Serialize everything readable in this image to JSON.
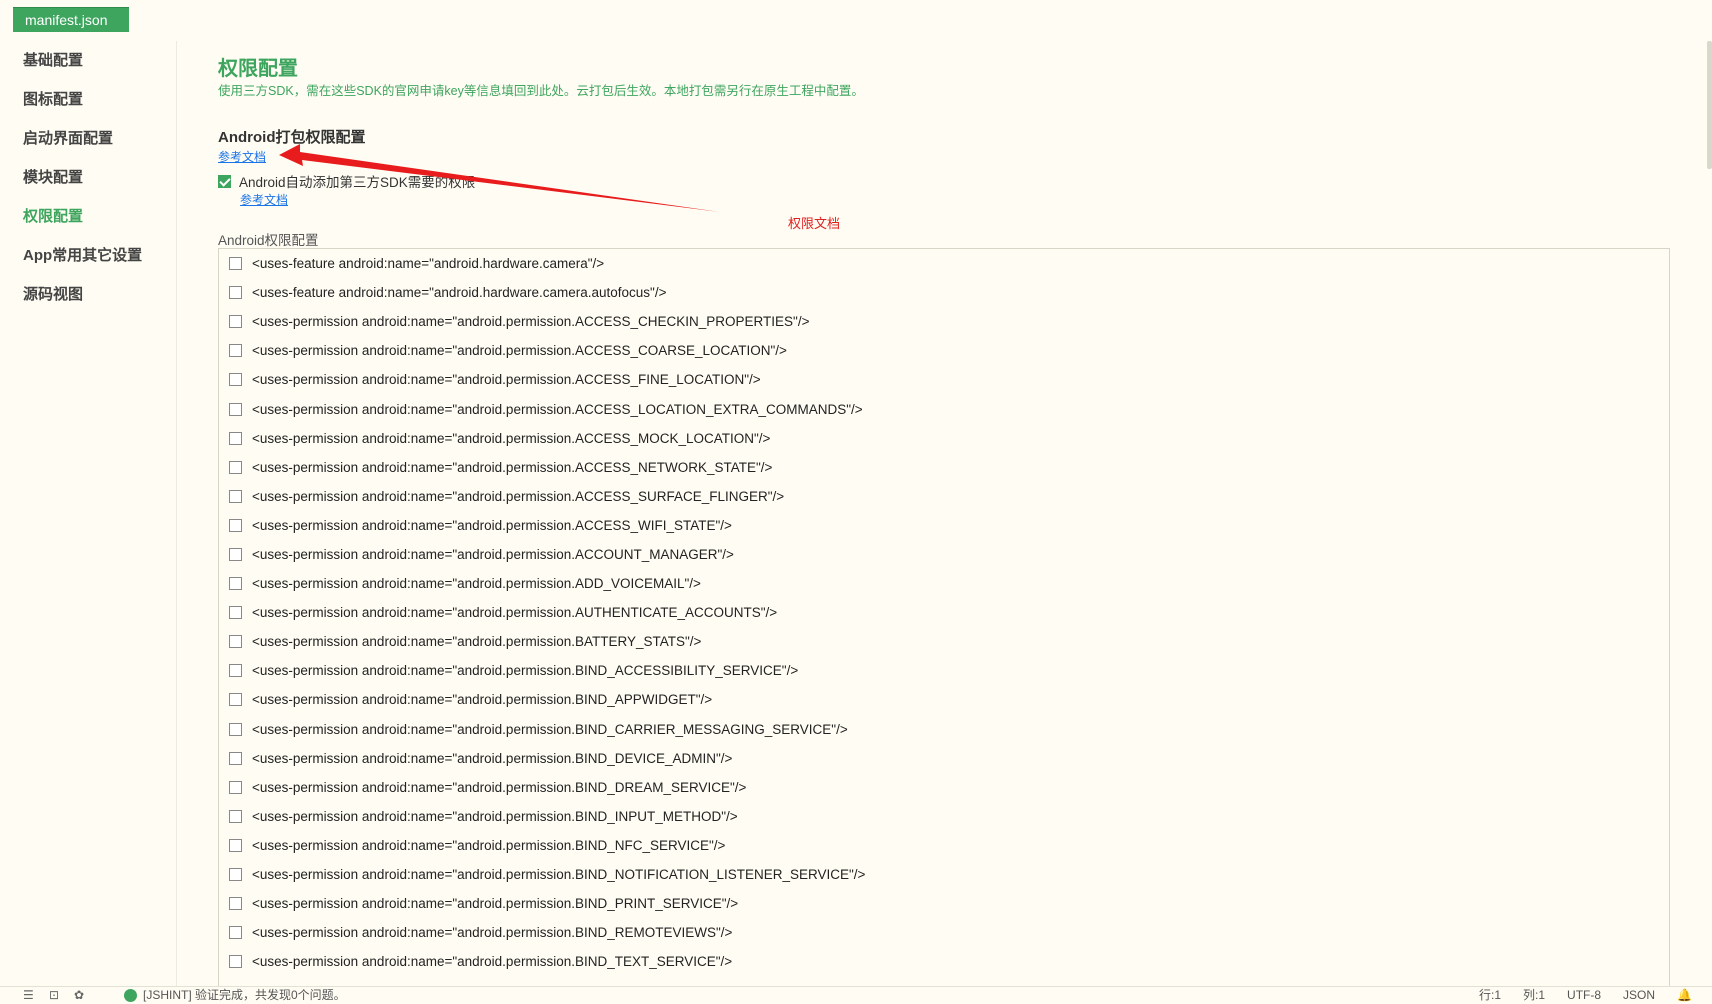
{
  "tab": {
    "label": "manifest.json"
  },
  "sidebar": {
    "items": [
      {
        "label": "基础配置",
        "active": false
      },
      {
        "label": "图标配置",
        "active": false
      },
      {
        "label": "启动界面配置",
        "active": false
      },
      {
        "label": "模块配置",
        "active": false
      },
      {
        "label": "权限配置",
        "active": true
      },
      {
        "label": "App常用其它设置",
        "active": false
      },
      {
        "label": "源码视图",
        "active": false
      }
    ]
  },
  "main": {
    "title": "权限配置",
    "description": "使用三方SDK，需在这些SDK的官网申请key等信息填回到此处。云打包后生效。本地打包需另行在原生工程中配置。",
    "android_section_title": "Android打包权限配置",
    "doc_link": "参考文档",
    "auto_add_label": "Android自动添加第三方SDK需要的权限",
    "auto_add_checked": true,
    "auto_doc_link": "参考文档",
    "perm_list_label": "Android权限配置",
    "permissions": [
      "<uses-feature android:name=\"android.hardware.camera\"/>",
      "<uses-feature android:name=\"android.hardware.camera.autofocus\"/>",
      "<uses-permission android:name=\"android.permission.ACCESS_CHECKIN_PROPERTIES\"/>",
      "<uses-permission android:name=\"android.permission.ACCESS_COARSE_LOCATION\"/>",
      "<uses-permission android:name=\"android.permission.ACCESS_FINE_LOCATION\"/>",
      "<uses-permission android:name=\"android.permission.ACCESS_LOCATION_EXTRA_COMMANDS\"/>",
      "<uses-permission android:name=\"android.permission.ACCESS_MOCK_LOCATION\"/>",
      "<uses-permission android:name=\"android.permission.ACCESS_NETWORK_STATE\"/>",
      "<uses-permission android:name=\"android.permission.ACCESS_SURFACE_FLINGER\"/>",
      "<uses-permission android:name=\"android.permission.ACCESS_WIFI_STATE\"/>",
      "<uses-permission android:name=\"android.permission.ACCOUNT_MANAGER\"/>",
      "<uses-permission android:name=\"android.permission.ADD_VOICEMAIL\"/>",
      "<uses-permission android:name=\"android.permission.AUTHENTICATE_ACCOUNTS\"/>",
      "<uses-permission android:name=\"android.permission.BATTERY_STATS\"/>",
      "<uses-permission android:name=\"android.permission.BIND_ACCESSIBILITY_SERVICE\"/>",
      "<uses-permission android:name=\"android.permission.BIND_APPWIDGET\"/>",
      "<uses-permission android:name=\"android.permission.BIND_CARRIER_MESSAGING_SERVICE\"/>",
      "<uses-permission android:name=\"android.permission.BIND_DEVICE_ADMIN\"/>",
      "<uses-permission android:name=\"android.permission.BIND_DREAM_SERVICE\"/>",
      "<uses-permission android:name=\"android.permission.BIND_INPUT_METHOD\"/>",
      "<uses-permission android:name=\"android.permission.BIND_NFC_SERVICE\"/>",
      "<uses-permission android:name=\"android.permission.BIND_NOTIFICATION_LISTENER_SERVICE\"/>",
      "<uses-permission android:name=\"android.permission.BIND_PRINT_SERVICE\"/>",
      "<uses-permission android:name=\"android.permission.BIND_REMOTEVIEWS\"/>",
      "<uses-permission android:name=\"android.permission.BIND_TEXT_SERVICE\"/>"
    ]
  },
  "annotation": {
    "text": "权限文档",
    "color": "#e02020"
  },
  "statusbar": {
    "message": "[JSHINT] 验证完成，共发现0个问题。",
    "line": "行:1",
    "column": "列:1",
    "encoding": "UTF-8",
    "language": "JSON"
  },
  "colors": {
    "accent": "#3ea55f",
    "link": "#1a73e8",
    "background": "#fffdf3"
  }
}
